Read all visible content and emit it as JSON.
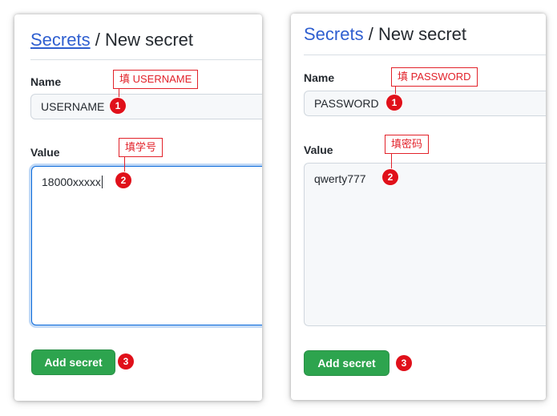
{
  "left_form": {
    "breadcrumb_link": "Secrets",
    "breadcrumb_sep": "/",
    "breadcrumb_page": "New secret",
    "name_label": "Name",
    "name_value": "USERNAME",
    "value_label": "Value",
    "value_text": "18000xxxxx",
    "submit_label": "Add secret"
  },
  "right_form": {
    "breadcrumb_link": "Secrets",
    "breadcrumb_sep": "/",
    "breadcrumb_page": "New secret",
    "name_label": "Name",
    "name_value": "PASSWORD",
    "value_label": "Value",
    "value_text": "qwerty777",
    "submit_label": "Add secret"
  },
  "annotations": {
    "left": {
      "name_note": "填 USERNAME",
      "value_note": "填学号"
    },
    "right": {
      "name_note": "填 PASSWORD",
      "value_note": "填密码"
    },
    "steps": [
      "1",
      "2",
      "3"
    ]
  },
  "colors": {
    "link": "#2f5fd0",
    "button_green": "#2da44e",
    "annotation_red": "#e2222a",
    "focus_blue": "#0969da"
  }
}
